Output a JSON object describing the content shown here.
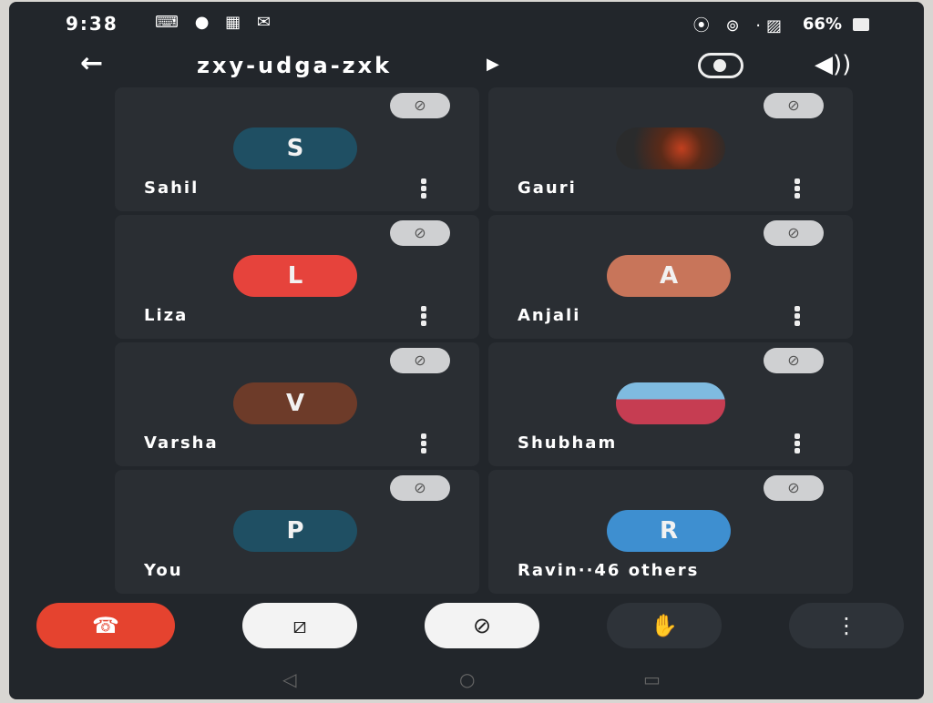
{
  "status": {
    "time": "9:38",
    "battery": "66%"
  },
  "header": {
    "title": "zxy-udga-zxk",
    "back_icon": "arrow-left-icon",
    "switch_camera_icon": "camera-flip-icon",
    "speaker_icon": "speaker-icon"
  },
  "participants": [
    {
      "name": "Sahil",
      "initial": "S",
      "color": "#1f4f63",
      "mic": "muted"
    },
    {
      "name": "Gauri",
      "initial": "",
      "color": "#3a3431",
      "mic": "muted",
      "photo": true
    },
    {
      "name": "Liza",
      "initial": "L",
      "color": "#e6433c",
      "mic": "muted"
    },
    {
      "name": "Anjali",
      "initial": "A",
      "color": "#c8755a",
      "mic": "muted"
    },
    {
      "name": "Varsha",
      "initial": "V",
      "color": "#6d3b29",
      "mic": "muted"
    },
    {
      "name": "Shubham",
      "initial": "",
      "color": "#2b7fb6",
      "mic": "muted",
      "photo": true
    },
    {
      "name": "You",
      "initial": "P",
      "color": "#1f4f63",
      "mic": "muted"
    },
    {
      "name": "Ravin··46 others",
      "initial": "R",
      "color": "#3e8fd0",
      "mic": "muted"
    }
  ],
  "controls": {
    "end_call_icon": "phone-hangup-icon",
    "camera_off_icon": "video-off-icon",
    "mic_off_icon": "mic-off-icon",
    "raise_hand_icon": "hand-icon",
    "more_icon": "more-vert-icon"
  }
}
